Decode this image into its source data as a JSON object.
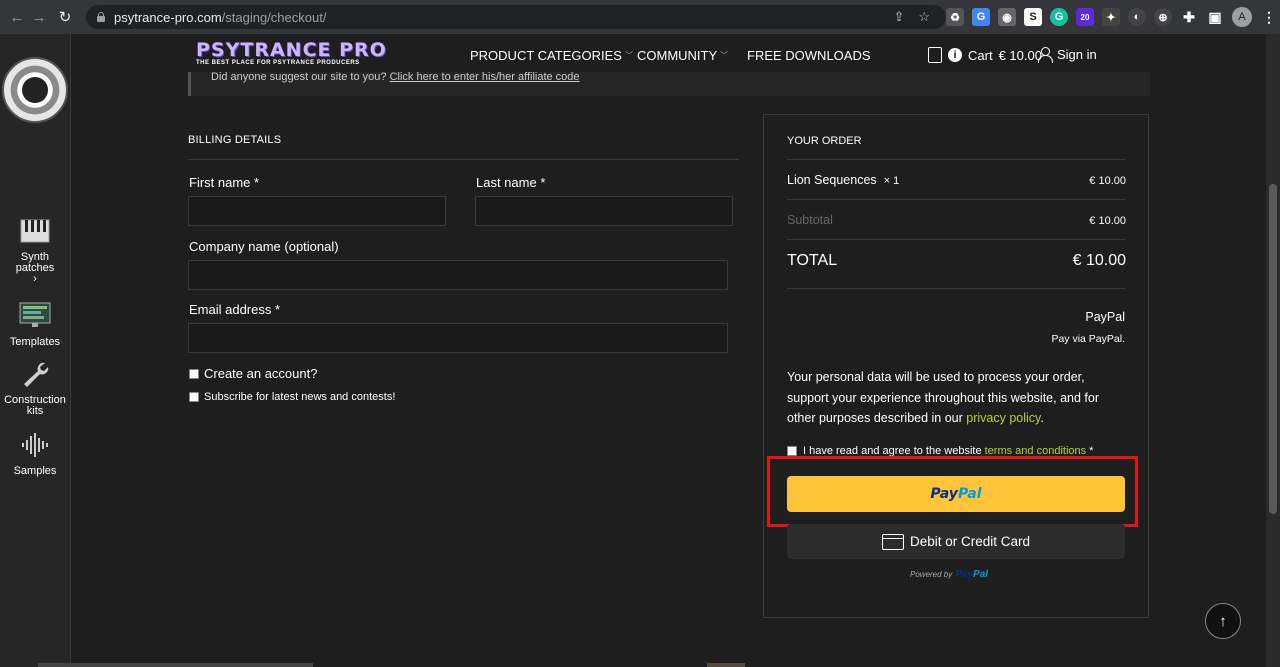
{
  "browser": {
    "url_host": "psytrance-pro.com",
    "url_path": "/staging/checkout/",
    "ext_badge": "20",
    "avatar_initial": "A"
  },
  "site": {
    "logo_text": "PSYTRANCE PRO",
    "logo_tagline": "THE BEST PLACE FOR PSYTRANCE PRODUCERS",
    "nav": [
      {
        "label": "PRODUCT CATEGORIES"
      },
      {
        "label": "COMMUNITY"
      },
      {
        "label": "FREE DOWNLOADS"
      }
    ],
    "cart_label": "Cart",
    "cart_total": "€ 10.00",
    "signin_label": "Sign in"
  },
  "sidebar": {
    "items": [
      {
        "label_line1": "Synth",
        "label_line2": "patches",
        "chevron": "›"
      },
      {
        "label_line1": "Templates"
      },
      {
        "label_line1": "Construction",
        "label_line2": "kits"
      },
      {
        "label_line1": "Samples"
      }
    ]
  },
  "notice": {
    "text": "Did anyone suggest our site to you?",
    "link": "Click here to enter his/her affiliate code"
  },
  "billing": {
    "title": "BILLING DETAILS",
    "first_name_label": "First name *",
    "last_name_label": "Last name *",
    "company_label": "Company name (optional)",
    "email_label": "Email address *",
    "create_account_label": "Create an account?",
    "subscribe_label": "Subscribe for latest news and contests!"
  },
  "order": {
    "title": "YOUR ORDER",
    "item_name": "Lion Sequences",
    "item_qty": "× 1",
    "item_price": "€ 10.00",
    "subtotal_label": "Subtotal",
    "subtotal_value": "€ 10.00",
    "total_label": "TOTAL",
    "total_value": "€ 10.00",
    "payment_method": "PayPal",
    "payment_desc": "Pay via PayPal.",
    "privacy_text": "Your personal data will be used to process your order, support your experience throughout this website, and for other purposes described in our ",
    "privacy_link": "privacy policy",
    "privacy_end": ".",
    "terms_text": "I have read and agree to the website ",
    "terms_link": "terms and conditions",
    "terms_star": " *",
    "paypal_btn_a": "Pay",
    "paypal_btn_b": "Pal",
    "card_btn": "Debit or Credit Card",
    "powered_by": "Powered by",
    "powered_a": "Pay",
    "powered_b": "Pal"
  },
  "colors": {
    "accent_green": "#b5d334",
    "paypal_yellow": "#ffc439",
    "highlight_red": "#e1151a"
  }
}
